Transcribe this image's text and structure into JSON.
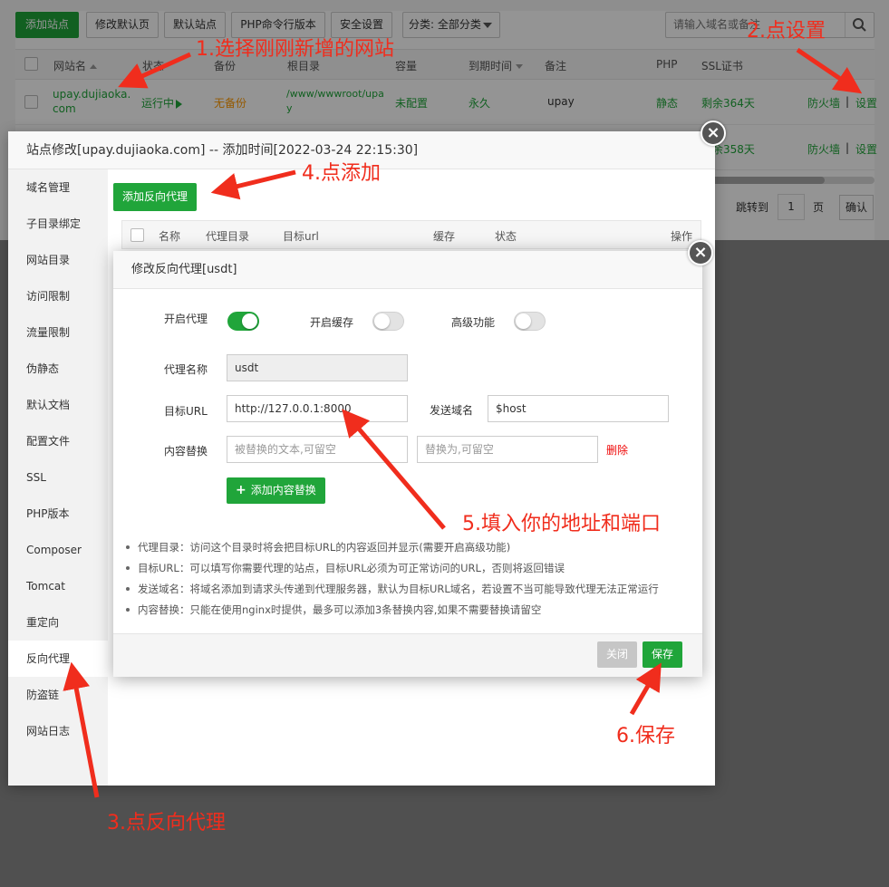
{
  "toolbar": {
    "add_site": "添加站点",
    "edit_default_page": "修改默认页",
    "default_site": "默认站点",
    "php_cli": "PHP命令行版本",
    "security": "安全设置",
    "category": "分类: 全部分类"
  },
  "search": {
    "placeholder": "请输入域名或备注"
  },
  "table": {
    "headers": [
      "网站名",
      "状态",
      "备份",
      "根目录",
      "容量",
      "到期时间",
      "备注",
      "PHP",
      "SSL证书"
    ],
    "rows": [
      {
        "site_line1": "upay.dujiaoka.",
        "site_line2": "com",
        "status": "运行中",
        "backup": "无备份",
        "root_line1": "/www/wwwroot/upa",
        "root_line2": "y",
        "capacity": "未配置",
        "expire": "永久",
        "note": "upay",
        "php": "静态",
        "ssl": "剩余364天",
        "firewall": "防火墙",
        "sep": "|",
        "settings": "设置"
      },
      {
        "ssl": "剩余358天",
        "firewall": "防火墙",
        "sep": "|",
        "settings": "设置"
      }
    ]
  },
  "pager": {
    "jump_to": "跳转到",
    "page_num": "1",
    "page_unit": "页",
    "confirm": "确认"
  },
  "site_dialog": {
    "title": "站点修改[upay.dujiaoka.com] -- 添加时间[2022-03-24 22:15:30]",
    "sidebar": [
      "域名管理",
      "子目录绑定",
      "网站目录",
      "访问限制",
      "流量限制",
      "伪静态",
      "默认文档",
      "配置文件",
      "SSL",
      "PHP版本",
      "Composer",
      "Tomcat",
      "重定向",
      "反向代理",
      "防盗链",
      "网站日志"
    ],
    "active_index": 13,
    "add_proxy": "添加反向代理",
    "proxy_headers": [
      "名称",
      "代理目录",
      "目标url",
      "缓存",
      "状态",
      "操作"
    ],
    "close_icon": "close-icon"
  },
  "proxy_dialog": {
    "title": "修改反向代理[usdt]",
    "enable_proxy": "开启代理",
    "enable_proxy_on": true,
    "enable_cache": "开启缓存",
    "enable_cache_on": false,
    "advanced": "高级功能",
    "advanced_on": false,
    "proxy_name_label": "代理名称",
    "proxy_name_value": "usdt",
    "target_url_label": "目标URL",
    "target_url_value": "http://127.0.0.1:8000",
    "send_domain_label": "发送域名",
    "send_domain_value": "$host",
    "content_replace_label": "内容替换",
    "replace_from_placeholder": "被替换的文本,可留空",
    "replace_to_placeholder": "替换为,可留空",
    "delete": "删除",
    "add_replace": "添加内容替换",
    "tips": [
      "代理目录：访问这个目录时将会把目标URL的内容返回并显示(需要开启高级功能)",
      "目标URL：可以填写你需要代理的站点，目标URL必须为可正常访问的URL，否则将返回错误",
      "发送域名：将域名添加到请求头传递到代理服务器，默认为目标URL域名，若设置不当可能导致代理无法正常运行",
      "内容替换：只能在使用nginx时提供，最多可以添加3条替换内容,如果不需要替换请留空"
    ],
    "close_btn": "关闭",
    "save_btn": "保存"
  },
  "annotations": {
    "a1": "1.选择刚刚新增的网站",
    "a2": "2.点设置",
    "a3": "3.点反向代理",
    "a4": "4.点添加",
    "a5": "5.填入你的地址和端口",
    "a6": "6.保存"
  },
  "colors": {
    "brand_green": "#20a53a",
    "annotation_red": "#f02d1d",
    "delete_red": "#ef0808",
    "warn_orange": "#ff9900"
  }
}
